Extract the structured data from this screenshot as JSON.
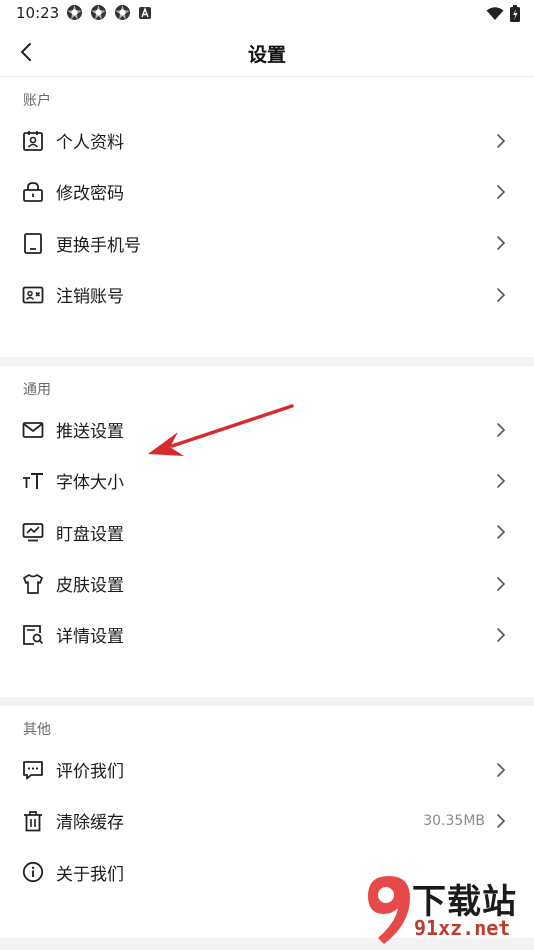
{
  "status_bar": {
    "time": "10:23"
  },
  "nav": {
    "title": "设置"
  },
  "sections": [
    {
      "header": "账户",
      "items": [
        {
          "label": "个人资料",
          "icon": "profile-card-icon"
        },
        {
          "label": "修改密码",
          "icon": "lock-icon"
        },
        {
          "label": "更换手机号",
          "icon": "phone-icon"
        },
        {
          "label": "注销账号",
          "icon": "id-card-x-icon"
        }
      ]
    },
    {
      "header": "通用",
      "items": [
        {
          "label": "推送设置",
          "icon": "mail-icon"
        },
        {
          "label": "字体大小",
          "icon": "font-size-icon"
        },
        {
          "label": "盯盘设置",
          "icon": "monitor-chart-icon"
        },
        {
          "label": "皮肤设置",
          "icon": "shirt-icon"
        },
        {
          "label": "详情设置",
          "icon": "detail-search-icon"
        }
      ]
    },
    {
      "header": "其他",
      "items": [
        {
          "label": "评价我们",
          "icon": "comment-icon"
        },
        {
          "label": "清除缓存",
          "icon": "trash-icon",
          "value": "30.35MB"
        },
        {
          "label": "关于我们",
          "icon": "info-icon"
        }
      ]
    }
  ],
  "watermark": {
    "line1": "下载站",
    "line2": "91xz.net"
  },
  "colors": {
    "arrow": "#d62b2b",
    "divider": "#f3f3f3",
    "text": "#1c1c1c",
    "muted": "#6a6a6a"
  }
}
